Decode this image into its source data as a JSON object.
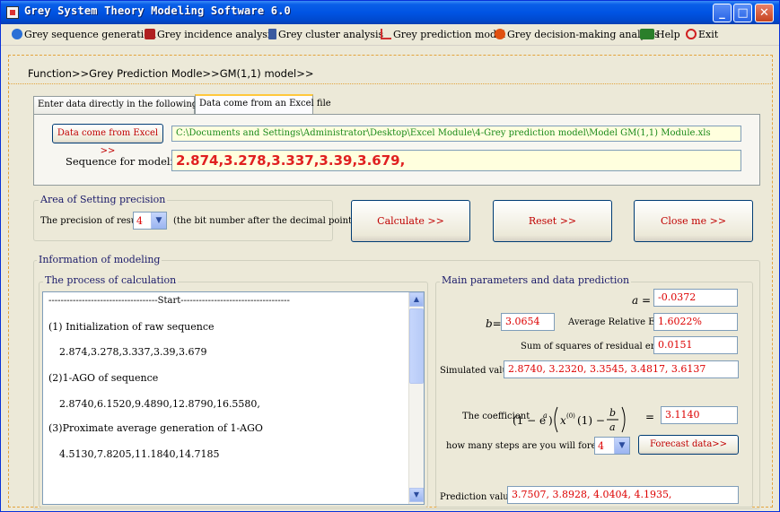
{
  "window": {
    "title": "Grey System Theory Modeling Software 6.0",
    "controls": [
      "_",
      "□",
      "✕"
    ]
  },
  "menu": [
    {
      "label": "Grey sequence generation",
      "icon": "sequence-icon",
      "color": "#2a6fd6"
    },
    {
      "label": "Grey incidence analysis",
      "icon": "incidence-icon",
      "color": "#b02020"
    },
    {
      "label": "Grey cluster analysis",
      "icon": "cluster-icon",
      "color": "#3a5aa0"
    },
    {
      "label": "Grey prediction model",
      "icon": "prediction-icon",
      "color": "#d03030"
    },
    {
      "label": "Grey decision-making analysis",
      "icon": "decision-icon",
      "color": "#e05010"
    },
    {
      "label": "Help",
      "icon": "help-icon",
      "color": "#2a7f2a"
    },
    {
      "label": "Exit",
      "icon": "exit-icon",
      "color": "#d02020"
    }
  ],
  "breadcrumb": "Function>>Grey Prediction Modle>>GM(1,1) model>>",
  "tabs": [
    {
      "label": "Enter data directly in the following Textbox",
      "active": false
    },
    {
      "label": "Data come from an Excel file",
      "active": true
    }
  ],
  "excel": {
    "button_label": "Data come from Excel >>",
    "path": "C:\\Documents and Settings\\Administrator\\Desktop\\Excel Module\\4-Grey prediction model\\Model GM(1,1) Module.xls",
    "sequence_label": "Sequence for modeling",
    "sequence_value": "2.874,3.278,3.337,3.39,3.679,"
  },
  "precision": {
    "group_title": "Area of Setting precision",
    "label": "The precision of results",
    "value": "4",
    "note": "(the bit number after the decimal point)"
  },
  "actions": {
    "calculate": "Calculate >>",
    "reset": "Reset >>",
    "close": "Close me >>"
  },
  "modeling": {
    "group_title": "Information of modeling",
    "process_title": "The process of calculation",
    "process_lines": [
      "------------------------------------Start------------------------------------",
      "(1) Initialization of raw sequence",
      "2.874,3.278,3.337,3.39,3.679",
      "(2)1-AGO of sequence",
      "2.8740,6.1520,9.4890,12.8790,16.5580,",
      "(3)Proximate average generation of  1-AGO",
      "4.5130,7.8205,11.1840,14.7185"
    ]
  },
  "params": {
    "title": "Main parameters and data prediction",
    "a_label": "a =",
    "a_value": "-0.0372",
    "b_label": "b=",
    "b_value": "3.0654",
    "are_label": "Average Relative Error",
    "are_value": "1.6022%",
    "ssr_label": "Sum of squares of residual  error",
    "ssr_value": "0.0151",
    "sim_label": "Simulated values",
    "sim_value": "2.8740, 3.2320, 3.3545, 3.4817, 3.6137",
    "coef_label": "The coefficient",
    "coef_eq": "=",
    "coef_value": "3.1140",
    "steps_label": "how many steps are you will forecast ?",
    "steps_value": "4",
    "forecast_button": "Forecast data>>",
    "pred_label": "Prediction values",
    "pred_value": "3.7507, 3.8928, 4.0404, 4.1935,"
  }
}
